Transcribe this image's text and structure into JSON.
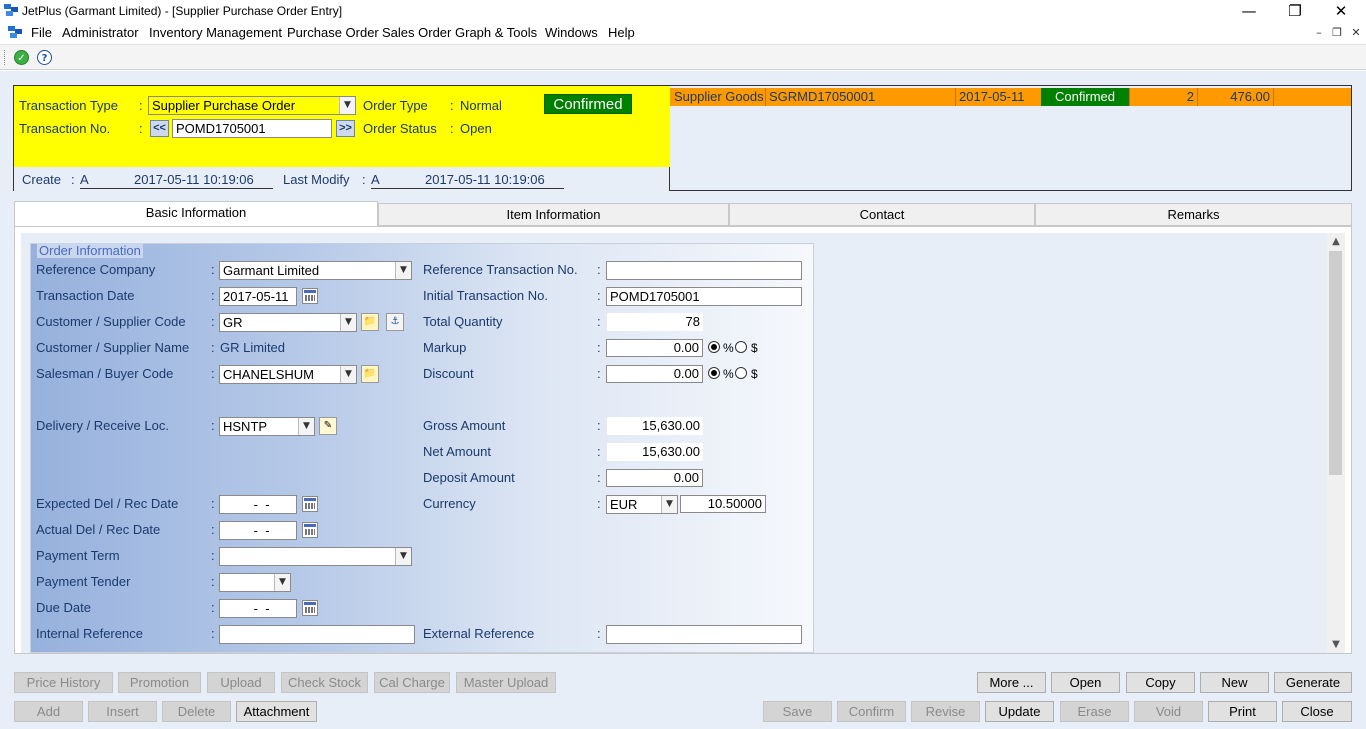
{
  "window": {
    "title": "JetPlus (Garmant Limited) - [Supplier Purchase Order Entry]",
    "minimize": "—",
    "restore": "❐",
    "close": "✕"
  },
  "menu": {
    "items": [
      "File",
      "Administrator",
      "Inventory Management",
      "Purchase Order",
      "Sales Order",
      "Graph & Tools",
      "Windows",
      "Help"
    ],
    "mdi_min": "–",
    "mdi_restore": "❐",
    "mdi_close": "✕"
  },
  "toolbar": {
    "check_icon": "check-icon",
    "help_icon": "help-icon",
    "check_glyph": "✓",
    "help_glyph": "?"
  },
  "header": {
    "transaction_type_label": "Transaction Type",
    "colon": ":",
    "transaction_type_value": "Supplier Purchase Order",
    "order_type_label": "Order Type",
    "order_type_value": "Normal",
    "status_badge": "Confirmed",
    "transaction_no_label": "Transaction No.",
    "prev_button": "<<",
    "transaction_no_value": "POMD1705001",
    "next_button": ">>",
    "order_status_label": "Order Status",
    "order_status_value": "Open",
    "create_label": "Create",
    "create_user": "A",
    "create_time": "2017-05-11 10:19:06",
    "last_modify_label": "Last Modify",
    "modify_user": "A",
    "modify_time": "2017-05-11 10:19:06"
  },
  "related": {
    "rows": [
      {
        "type": "Supplier Goods",
        "code": "SGRMD17050001",
        "date": "2017-05-11",
        "status": "Confirmed",
        "count": "2",
        "amount": "476.00"
      }
    ]
  },
  "tabs": [
    "Basic Information",
    "Item Information",
    "Contact",
    "Remarks"
  ],
  "order_info": {
    "group_title": "Order Information",
    "colon": ":",
    "reference_company_label": "Reference Company",
    "reference_company_value": "Garmant Limited",
    "transaction_date_label": "Transaction Date",
    "transaction_date_value": "2017-05-11",
    "customer_code_label": "Customer / Supplier Code",
    "customer_code_value": "GR",
    "customer_name_label": "Customer / Supplier Name",
    "customer_name_value": "GR Limited",
    "salesman_label": "Salesman / Buyer Code",
    "salesman_value": "CHANELSHUM",
    "delivery_loc_label": "Delivery / Receive Loc.",
    "delivery_loc_value": "HSNTP",
    "expected_date_label": "Expected Del / Rec Date",
    "expected_date_value": "  -  -",
    "actual_date_label": "Actual Del / Rec Date",
    "actual_date_value": "  -  -",
    "payment_term_label": "Payment Term",
    "payment_term_value": "",
    "payment_tender_label": "Payment Tender",
    "payment_tender_value": "",
    "due_date_label": "Due Date",
    "due_date_value": "  -  -",
    "internal_ref_label": "Internal Reference",
    "internal_ref_value": "",
    "ref_txn_label": "Reference Transaction No.",
    "ref_txn_value": "",
    "initial_txn_label": "Initial Transaction No.",
    "initial_txn_value": "POMD1705001",
    "total_qty_label": "Total Quantity",
    "total_qty_value": "78",
    "markup_label": "Markup",
    "markup_value": "0.00",
    "discount_label": "Discount",
    "discount_value": "0.00",
    "percent_label": "%",
    "dollar_label": "$",
    "gross_label": "Gross Amount",
    "gross_value": "15,630.00",
    "net_label": "Net Amount",
    "net_value": "15,630.00",
    "deposit_label": "Deposit Amount",
    "deposit_value": "0.00",
    "currency_label": "Currency",
    "currency_value": "EUR",
    "exchange_rate": "10.50000",
    "external_ref_label": "External Reference",
    "external_ref_value": ""
  },
  "buttons_row1_left": [
    "Price History",
    "Promotion",
    "Upload",
    "Check Stock",
    "Cal Charge",
    "Master Upload"
  ],
  "buttons_row1_right": [
    "More ...",
    "Open",
    "Copy",
    "New",
    "Generate"
  ],
  "buttons_row2_left": [
    "Add",
    "Insert",
    "Delete",
    "Attachment"
  ],
  "buttons_row2_right": [
    "Save",
    "Confirm",
    "Revise",
    "Update",
    "Erase",
    "Void",
    "Print",
    "Close"
  ],
  "colors": {
    "header_yellow": "#ffff00",
    "status_green": "#008000",
    "related_orange": "#ff9900",
    "label_navy": "#1b3a6b"
  }
}
